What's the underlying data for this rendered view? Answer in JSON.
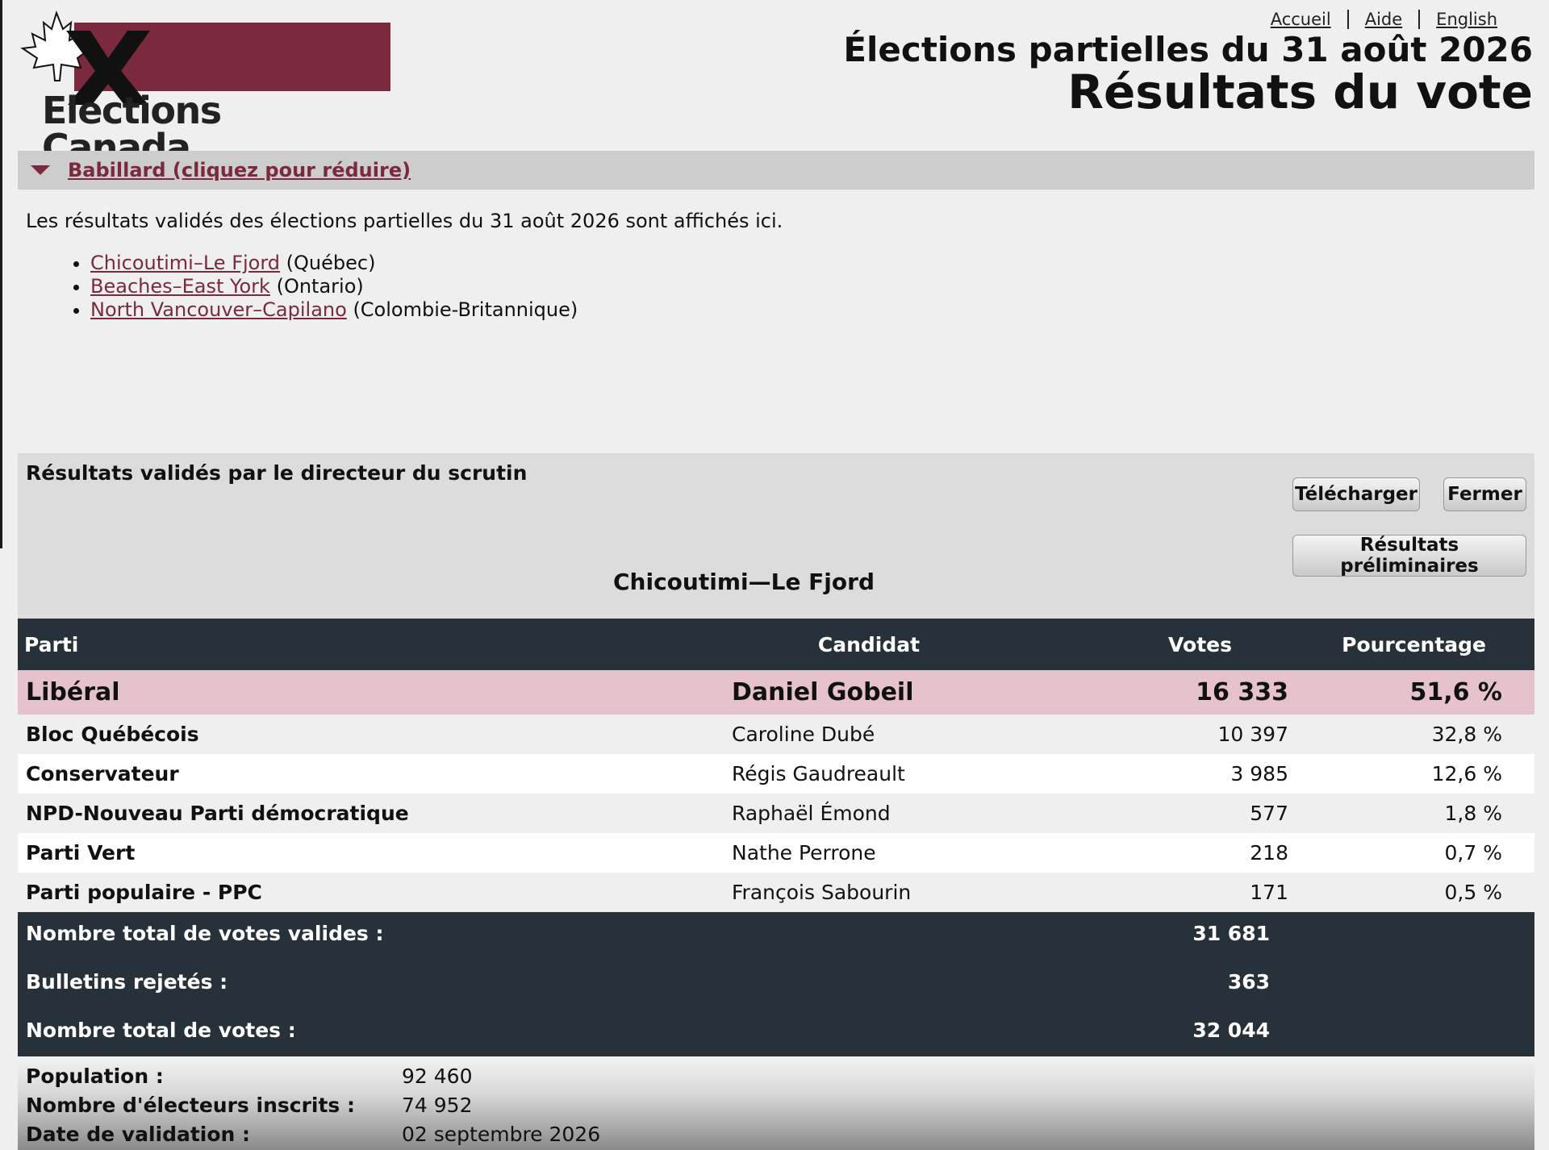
{
  "logo": {
    "wordmark": "Elections Canada",
    "colors": {
      "bar": "#7a2a3c"
    }
  },
  "header": {
    "links": [
      "Accueil",
      "Aide",
      "English"
    ],
    "title_line1": "Élections partielles du 31 août 2026",
    "title_line2": "Résultats du vote"
  },
  "babillard": {
    "toggle_label": "Babillard (cliquez pour réduire)",
    "text": "Les résultats validés des élections partielles du 31 août 2026 sont affichés ici.",
    "ridings": [
      {
        "name": "Chicoutimi–Le Fjord",
        "province": "(Québec)"
      },
      {
        "name": "Beaches–East York",
        "province": "(Ontario)"
      },
      {
        "name": "North Vancouver–Capilano",
        "province": "(Colombie-Britannique)"
      }
    ]
  },
  "panel": {
    "title": "Résultats validés par le directeur du scrutin",
    "download_label": "Télécharger",
    "close_label": "Fermer",
    "preliminary_label": "Résultats préliminaires",
    "riding": "Chicoutimi—Le Fjord"
  },
  "table": {
    "headers": {
      "party": "Parti",
      "candidate": "Candidat",
      "votes": "Votes",
      "percent": "Pourcentage"
    },
    "rows": [
      {
        "party": "Libéral",
        "candidate": "Daniel Gobeil",
        "votes": "16 333",
        "percent": "51,6 %"
      },
      {
        "party": "Bloc Québécois",
        "candidate": "Caroline Dubé",
        "votes": "10 397",
        "percent": "32,8 %"
      },
      {
        "party": "Conservateur",
        "candidate": "Régis Gaudreault",
        "votes": "3 985",
        "percent": "12,6 %"
      },
      {
        "party": "NPD-Nouveau Parti démocratique",
        "candidate": "Raphaël Émond",
        "votes": "577",
        "percent": "1,8 %"
      },
      {
        "party": "Parti Vert",
        "candidate": "Nathe Perrone",
        "votes": "218",
        "percent": "0,7 %"
      },
      {
        "party": "Parti populaire - PPC",
        "candidate": "François Sabourin",
        "votes": "171",
        "percent": "0,5 %"
      }
    ],
    "winner_color": "#e6c3cc"
  },
  "totals": {
    "valid_label": "Nombre total de votes valides :",
    "valid": "31 681",
    "rejected_label": "Bulletins rejetés :",
    "rejected": "363",
    "total_label": "Nombre total de votes :",
    "total": "32 044"
  },
  "stats": {
    "population_label": "Population :",
    "population": "92 460",
    "electors_label": "Nombre d'électeurs inscrits :",
    "electors": "74 952",
    "date_label": "Date de validation :",
    "date": "02 septembre 2026"
  }
}
